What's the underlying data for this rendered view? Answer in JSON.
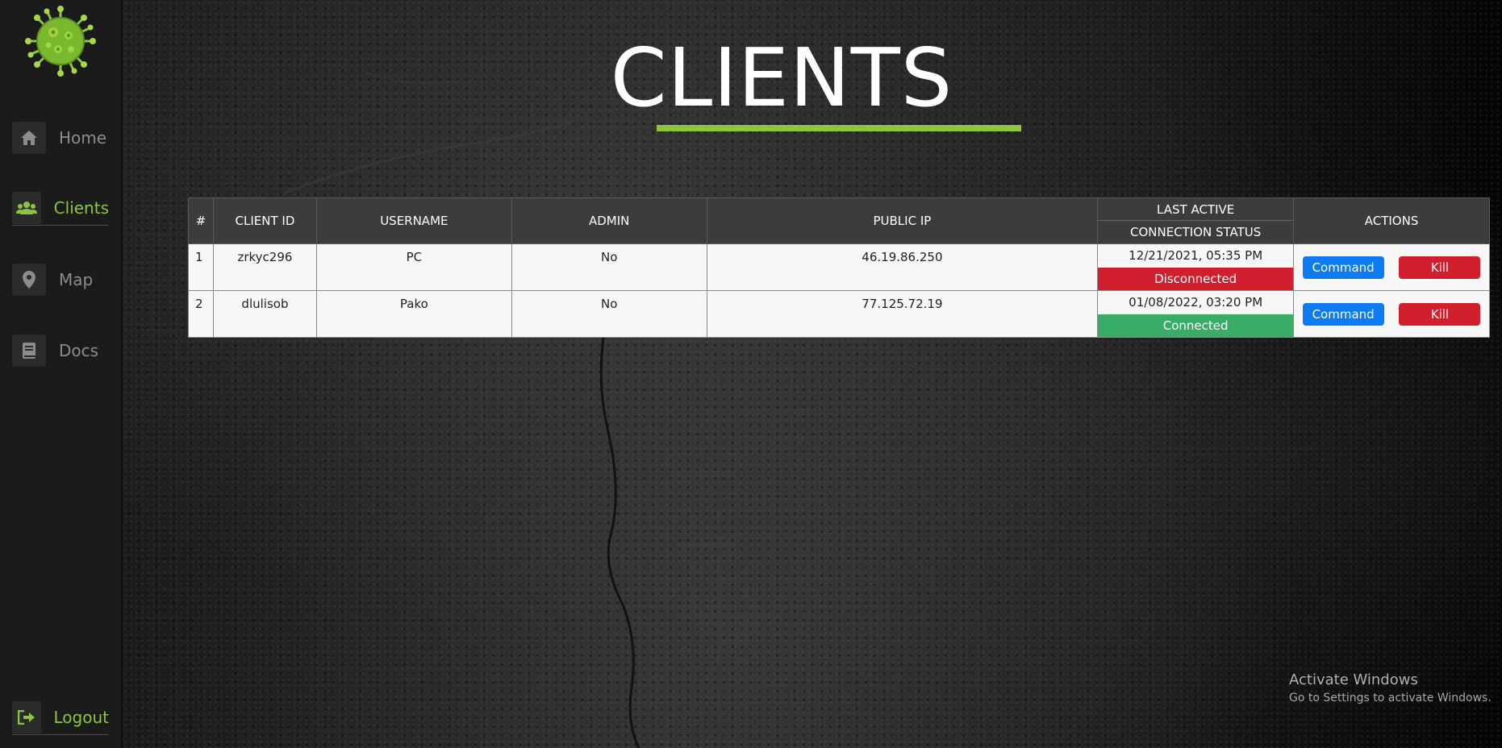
{
  "sidebar": {
    "items": [
      {
        "label": "Home",
        "icon": "home-icon"
      },
      {
        "label": "Clients",
        "icon": "users-icon"
      },
      {
        "label": "Map",
        "icon": "map-marker-icon"
      },
      {
        "label": "Docs",
        "icon": "book-icon"
      }
    ],
    "logout_label": "Logout",
    "active": "Clients",
    "accent_color": "#8cc63f"
  },
  "page": {
    "title": "CLIENTS"
  },
  "table": {
    "headers": {
      "index": "#",
      "client_id": "CLIENT ID",
      "username": "USERNAME",
      "admin": "ADMIN",
      "public_ip": "PUBLIC IP",
      "last_active": "LAST ACTIVE",
      "connection_status": "CONNECTION STATUS",
      "actions": "ACTIONS"
    },
    "rows": [
      {
        "index": "1",
        "client_id": "zrkyc296",
        "username": "PC",
        "admin": "No",
        "public_ip": "46.19.86.250",
        "last_active": "12/21/2021, 05:35 PM",
        "status": "Disconnected",
        "status_color": "#d11f2e",
        "command_label": "Command",
        "kill_label": "Kill"
      },
      {
        "index": "2",
        "client_id": "dlulisob",
        "username": "Pako",
        "admin": "No",
        "public_ip": "77.125.72.19",
        "last_active": "01/08/2022, 03:20 PM",
        "status": "Connected",
        "status_color": "#38ad67",
        "command_label": "Command",
        "kill_label": "Kill"
      }
    ]
  },
  "watermark": {
    "title": "Activate Windows",
    "subtitle": "Go to Settings to activate Windows."
  }
}
